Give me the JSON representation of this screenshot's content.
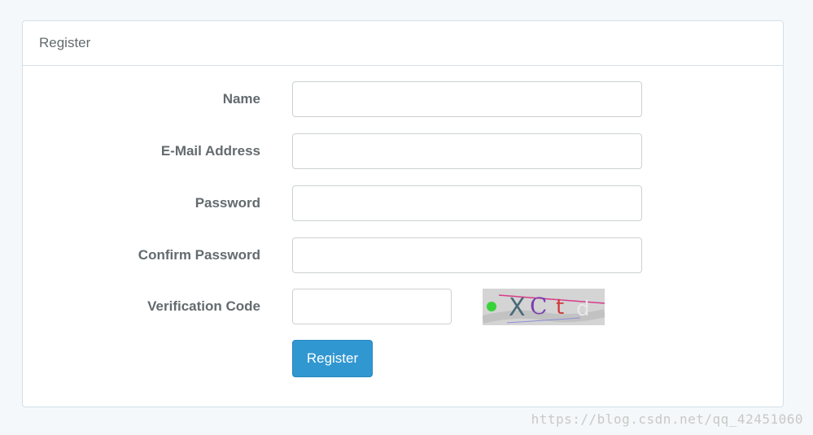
{
  "panel": {
    "heading": "Register"
  },
  "form": {
    "name_label": "Name",
    "name_value": "",
    "email_label": "E-Mail Address",
    "email_value": "",
    "password_label": "Password",
    "password_value": "",
    "confirm_label": "Confirm Password",
    "confirm_value": "",
    "verification_label": "Verification Code",
    "verification_value": "",
    "captcha_text": "exctd",
    "submit_label": "Register"
  },
  "colors": {
    "page_bg": "#f5f8fa",
    "button_bg": "#3097d1",
    "text": "#636b6f",
    "border": "#d3e0e9"
  },
  "watermark": "https://blog.csdn.net/qq_42451060"
}
